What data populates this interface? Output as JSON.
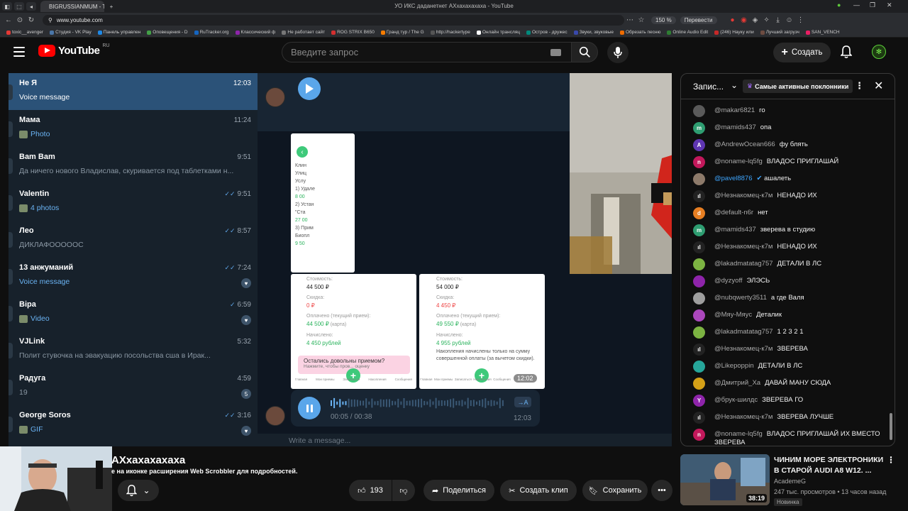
{
  "browser": {
    "tab_title": "BIGRUSSIANMUM - Twit",
    "window_title": "УО ИКС даданетнет АХхахахахаха - YouTube",
    "url": "www.youtube.com",
    "zoom": "150 %",
    "translate_label": "Перевести",
    "bookmarks": [
      "toxic__avenger",
      "Студия - VK Play",
      "Панель управлен",
      "Оповещения - D",
      "RuTracker.org",
      "Классический ф",
      "Не работает сайт",
      "ROG STRIX B650",
      "Гранд тур / The G",
      "http://hackertype",
      "Онлайн трансляц",
      "Остров - дружес",
      "Звуки, звуковые",
      "Обрезать песню",
      "Online Audio Edit",
      "(246) Науку или",
      "Лучший загрузч",
      "SAN_VENCH"
    ]
  },
  "yt_header": {
    "logo_text": "YouTube",
    "logo_region": "RU",
    "search_placeholder": "Введите запрос",
    "create_label": "Создать"
  },
  "telegram": {
    "chats": [
      {
        "name": "Не Я",
        "time": "12:03",
        "preview": "Voice message",
        "preview_style": "link",
        "active": true,
        "ticks": "",
        "badge": ""
      },
      {
        "name": "Мама",
        "time": "11:24",
        "preview": "Photo",
        "preview_style": "link",
        "active": false,
        "ticks": "",
        "badge": ""
      },
      {
        "name": "Bam Bam",
        "time": "9:51",
        "preview": "Да ничего нового Владислав, скуривается под таблетками н...",
        "preview_style": "grey",
        "active": false,
        "ticks": "",
        "badge": ""
      },
      {
        "name": "Valentin",
        "time": "9:51",
        "preview": "4 photos",
        "preview_style": "link",
        "active": false,
        "ticks": "✓✓",
        "badge": ""
      },
      {
        "name": "Лео",
        "time": "8:57",
        "preview": "ДИКЛАФОООООС",
        "preview_style": "grey",
        "active": false,
        "ticks": "✓✓",
        "badge": ""
      },
      {
        "name": "13 анжуманий",
        "time": "7:24",
        "preview": "Voice message",
        "preview_style": "link",
        "active": false,
        "ticks": "✓✓",
        "badge": "♥"
      },
      {
        "name": "Віра",
        "time": "6:59",
        "preview": "Video",
        "preview_style": "link",
        "active": false,
        "ticks": "✓",
        "badge": "♥"
      },
      {
        "name": "VJLink",
        "time": "5:32",
        "preview": "Полит стувочка на эвакуацию посольства сша  в Ирак...",
        "preview_style": "grey",
        "active": false,
        "ticks": "",
        "badge": ""
      },
      {
        "name": "Радуга",
        "time": "4:59",
        "preview": "19",
        "preview_style": "grey",
        "active": false,
        "ticks": "",
        "badge": "5"
      },
      {
        "name": "George Soros",
        "time": "3:16",
        "preview": "GIF",
        "preview_style": "link",
        "active": false,
        "ticks": "✓✓",
        "badge": "♥"
      }
    ],
    "voice": {
      "elapsed": "00:05 / 00:38",
      "time": "12:03",
      "transcribe": "→A"
    },
    "compose_placeholder": "Write a message...",
    "phone_left": {
      "cost_label": "Стоимость:",
      "cost": "44 500 ₽",
      "discount_label": "Скидка:",
      "discount": "0 ₽",
      "paid_label": "Оплачено (текущий прием):",
      "paid": "44 500 ₽",
      "paid_note": "(карта)",
      "accrued_label": "Начислено:",
      "accrued": "4 450 рублей",
      "banner": "Остались довольны приемом?",
      "banner_sub": "Нажмите, чтобы пров... оценку"
    },
    "phone_right": {
      "cost_label": "Стоимость:",
      "cost": "54 000 ₽",
      "discount_label": "Скидка:",
      "discount": "4 450 ₽",
      "paid_label": "Оплачено (текущий прием):",
      "paid": "49 550 ₽",
      "paid_note": "(карта)",
      "accrued_label": "Начислено:",
      "accrued": "4 955 рублей",
      "accrued_note": "Накопления начислены только на сумму совершенной оплаты (за вычетом скидки).",
      "timestamp": "12:02"
    },
    "phone_top": {
      "lines": [
        "Клин",
        "Улиц",
        "Услу",
        "1) Удале",
        "8 00",
        "2) Устан",
        "\"Ста",
        "27 00",
        "3) Прим",
        "Биопл",
        "9 50"
      ]
    },
    "phone_tabs": [
      "Главная",
      "Мои приемы",
      "Записаться",
      "Накопления",
      "Сообщения"
    ]
  },
  "livechat": {
    "title": "Запис...",
    "fans_label": "Самые активные поклонники",
    "messages": [
      {
        "user": "@makar6821",
        "text": "го",
        "color": "#5a5a5a",
        "letter": ""
      },
      {
        "user": "@mamids437",
        "text": "опа",
        "color": "#2e9d71",
        "letter": "m"
      },
      {
        "user": "@AndrewOcean666",
        "text": "фу блять",
        "color": "#5e35b1",
        "letter": "A"
      },
      {
        "user": "@noname-lq5fg",
        "text": "ВЛАДОС ПРИГЛАШАЙ",
        "color": "#c2185b",
        "letter": "n"
      },
      {
        "user": "@pavel8876",
        "text": "ашалеть",
        "color": "#8d7a6a",
        "letter": "",
        "verified": true
      },
      {
        "user": "@Незнакомец-к7м",
        "text": "НЕНАДО ИХ",
        "color": "#222",
        "letter": "ıl"
      },
      {
        "user": "@default-n6r",
        "text": "нет",
        "color": "#e67e22",
        "letter": "d"
      },
      {
        "user": "@mamids437",
        "text": "зверева в студию",
        "color": "#2e9d71",
        "letter": "m"
      },
      {
        "user": "@Незнакомец-к7м",
        "text": "НЕНАДО ИХ",
        "color": "#222",
        "letter": "ıl"
      },
      {
        "user": "@lakadmatatag757",
        "text": "ДЕТАЛИ В ЛС",
        "color": "#7cb342",
        "letter": ""
      },
      {
        "user": "@dyzyoff",
        "text": "ЭЛЭСЬ",
        "color": "#8e24aa",
        "letter": ""
      },
      {
        "user": "@nubqwerty3511",
        "text": "а где Валя",
        "color": "#9e9e9e",
        "letter": ""
      },
      {
        "user": "@Мяу-Мяус",
        "text": "Деталик",
        "color": "#ab47bc",
        "letter": ""
      },
      {
        "user": "@lakadmatatag757",
        "text": "1 2 3 2 1",
        "color": "#7cb342",
        "letter": ""
      },
      {
        "user": "@Незнакомец-к7м",
        "text": "ЗВЕРЕВА",
        "color": "#222",
        "letter": "ıl"
      },
      {
        "user": "@Likepoppin",
        "text": "ДЕТАЛИ В ЛС",
        "color": "#26a69a",
        "letter": ""
      },
      {
        "user": "@Дмитрий_Ха",
        "text": "ДАВАЙ МАНУ СЮДА",
        "color": "#d4a017",
        "letter": ""
      },
      {
        "user": "@брук-шилдс",
        "text": "ЗВЕРЕВА ГО",
        "color": "#8e24aa",
        "letter": "Y"
      },
      {
        "user": "@Незнакомец-к7м",
        "text": "ЗВЕРЕВА ЛУЧШЕ",
        "color": "#222",
        "letter": "ıl"
      },
      {
        "user": "@noname-lq5fg",
        "text": "ВЛАДОС ПРИГЛАШАЙ ИХ ВМЕСТО ЗВЕРЕВА",
        "color": "#c2185b",
        "letter": "n"
      }
    ]
  },
  "video": {
    "title": "АХхахахахаха",
    "scrobbler_note": "е на иконке расширения Web Scrobbler для подробностей.",
    "likes": "193",
    "share_label": "Поделиться",
    "clip_label": "Создать клип",
    "save_label": "Сохранить"
  },
  "recommended": {
    "title": "ЧИНИМ МОРЕ ЭЛЕКТРОНИКИ В СТАРОЙ AUDI A8 W12. ...",
    "channel": "AcademeG",
    "meta": "247 тыс. просмотров • 13 часов назад",
    "badge": "Новинка",
    "duration": "38:19"
  }
}
